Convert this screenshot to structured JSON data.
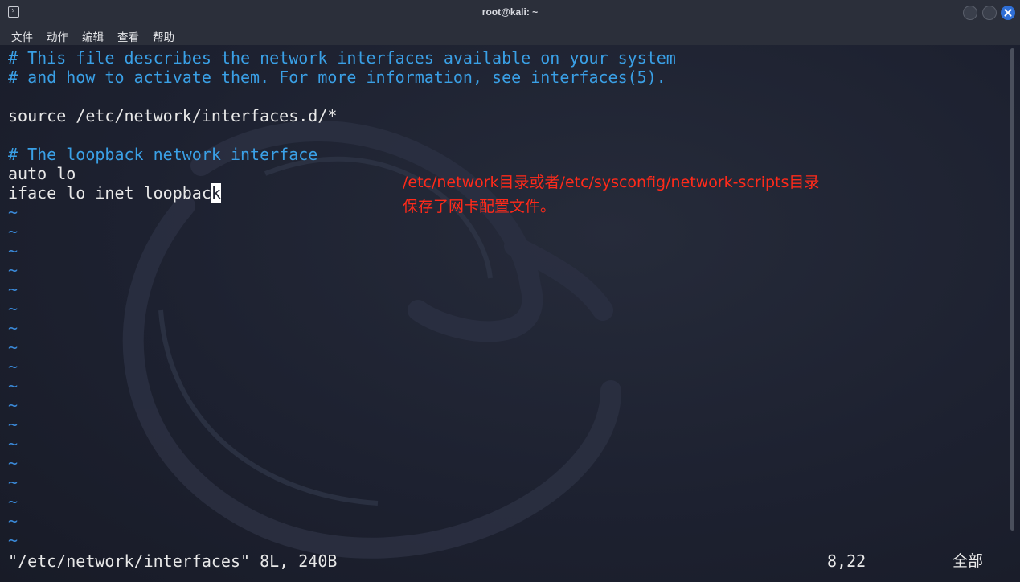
{
  "window": {
    "title": "root@kali: ~",
    "icon": "terminal-icon"
  },
  "menu": [
    "文件",
    "动作",
    "编辑",
    "查看",
    "帮助"
  ],
  "editor": {
    "lines": [
      {
        "text": "# This file describes the network interfaces available on your system",
        "kind": "comment"
      },
      {
        "text": "# and how to activate them. For more information, see interfaces(5).",
        "kind": "comment"
      },
      {
        "text": "",
        "kind": "normal"
      },
      {
        "text": "source /etc/network/interfaces.d/*",
        "kind": "normal"
      },
      {
        "text": "",
        "kind": "normal"
      },
      {
        "text": "# The loopback network interface",
        "kind": "comment"
      },
      {
        "text": "auto lo",
        "kind": "normal"
      },
      {
        "text": "iface lo inet loopbac",
        "kind": "normal"
      }
    ],
    "cursor_char": "k",
    "empty_line_marker": "~",
    "empty_line_count": 18
  },
  "annotation": {
    "line1": "/etc/network目录或者/etc/sysconfig/network-scripts目录",
    "line2": "保存了网卡配置文件。",
    "color": "#ff2a1a"
  },
  "status": {
    "file_info": "\"/etc/network/interfaces\" 8L, 240B",
    "position": "8,22",
    "scroll": "全部"
  }
}
